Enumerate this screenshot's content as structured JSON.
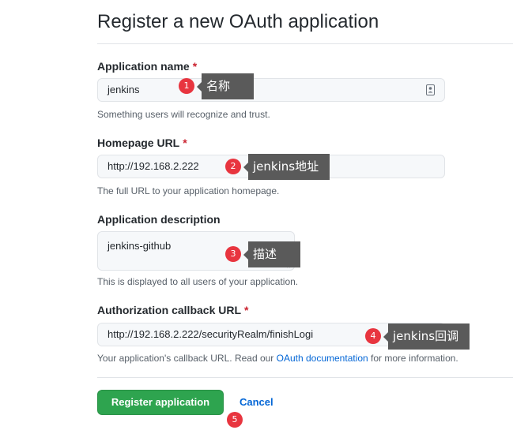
{
  "page": {
    "title": "Register a new OAuth application"
  },
  "form": {
    "app_name": {
      "label": "Application name",
      "required": "*",
      "value": "jenkins",
      "hint": "Something users will recognize and trust."
    },
    "homepage": {
      "label": "Homepage URL",
      "required": "*",
      "value": "http://192.168.2.222",
      "hint": "The full URL to your application homepage."
    },
    "description": {
      "label": "Application description",
      "value": "jenkins-github",
      "hint": "This is displayed to all users of your application."
    },
    "callback": {
      "label": "Authorization callback URL",
      "required": "*",
      "value": "http://192.168.2.222/securityRealm/finishLogi",
      "hint_before": "Your application's callback URL. Read our ",
      "hint_link": "OAuth documentation",
      "hint_after": " for more information."
    }
  },
  "actions": {
    "register_label": "Register application",
    "cancel_label": "Cancel"
  },
  "annotations": [
    {
      "number": "1",
      "text": "名称"
    },
    {
      "number": "2",
      "text": "jenkins地址"
    },
    {
      "number": "3",
      "text": "描述"
    },
    {
      "number": "4",
      "text": "jenkins回调"
    },
    {
      "number": "5"
    }
  ],
  "colors": {
    "primary_button": "#2ea44f",
    "link": "#0366d6",
    "required": "#cb2431",
    "marker": "#e8353f",
    "callout": "#5a5a5a"
  }
}
